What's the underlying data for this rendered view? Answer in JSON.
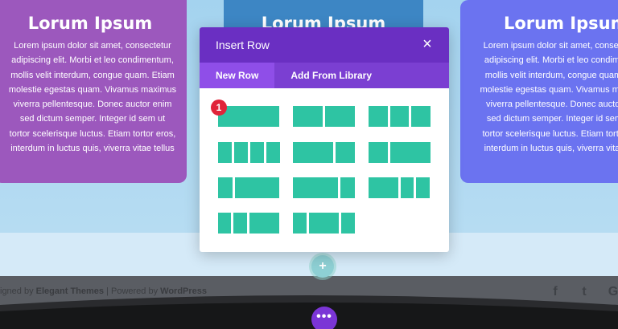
{
  "cards": [
    {
      "title": "Lorum Ipsum",
      "body": [
        "Lorem ipsum dolor sit amet, consectetur",
        "adipiscing elit. Morbi et leo condimentum,",
        "mollis velit interdum, congue quam. Etiam",
        "molestie egestas quam. Vivamus maximus",
        "viverra pellentesque. Donec auctor enim",
        "sed dictum semper. Integer id sem ut",
        "tortor scelerisque luctus. Etiam tortor eros,",
        "interdum in luctus quis, viverra vitae tellus"
      ]
    },
    {
      "title": "Lorum Ipsum"
    },
    {
      "title": "Lorum Ipsum",
      "body": [
        "Lorem ipsum dolor sit amet, consect",
        "adipiscing elit. Morbi et leo condime",
        "mollis velit interdum, congue quam.",
        "molestie egestas quam. Vivamus max",
        "viverra pellentesque. Donec auctor",
        "sed dictum semper. Integer id sem",
        "tortor scelerisque luctus. Etiam tortor",
        "interdum in luctus quis, viverra vitae"
      ]
    }
  ],
  "footer": {
    "text_prefix": "igned by",
    "elegant": "Elegant Themes",
    "separator": " | Powered by ",
    "wordpress": "WordPress"
  },
  "modal": {
    "title": "Insert Row",
    "close_icon": "×",
    "tabs": [
      {
        "label": "New Row",
        "active": true
      },
      {
        "label": "Add From Library",
        "active": false
      }
    ],
    "badge": "1"
  },
  "buttons": {
    "add_row": "+",
    "more": "•••"
  },
  "social": {
    "facebook": "f",
    "twitter": "t",
    "google": "G"
  },
  "colors": {
    "modal_header": "#6a2fc2",
    "tab_bar": "#7b3fd2",
    "active_tab": "#8f4ee8",
    "layout_block": "#2ec4a3",
    "badge": "#e0243a"
  }
}
